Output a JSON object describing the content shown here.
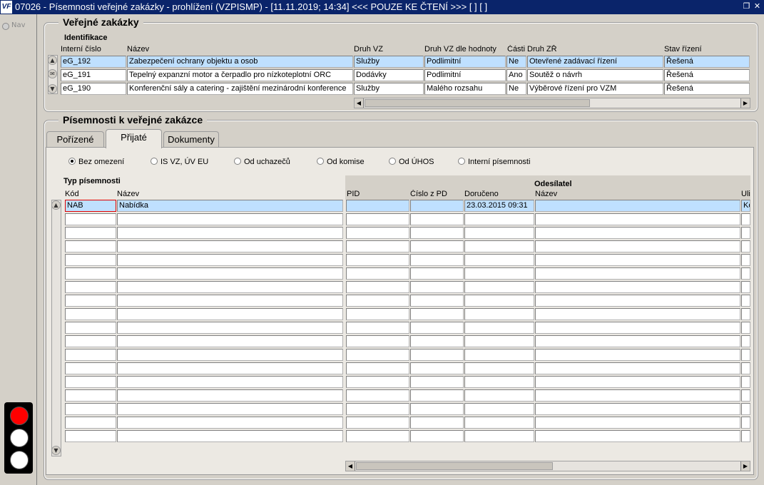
{
  "window": {
    "logo": "VF",
    "title": "07026 - Písemnosti veřejné zakázky - prohlížení (VZPISMP) - [11.11.2019; 14:34] <<< POUZE KE ČTENÍ >>>  [ ]  [ ]",
    "restore_icon": "restore-icon",
    "close_icon": "close-icon"
  },
  "left": {
    "nav_label": "Nav"
  },
  "section_vz": {
    "title": "Veřejné zakázky",
    "subtitle": "Identifikace",
    "columns": [
      "Interní číslo",
      "Název",
      "Druh VZ",
      "Druh VZ dle hodnoty",
      "Části",
      "Druh ZŘ",
      "Stav řízení"
    ],
    "rows": [
      [
        "eG_192",
        "Zabezpečení ochrany objektu a osob",
        "Služby",
        "Podlimitní",
        "Ne",
        "Otevřené zadávací řízení",
        "Řešená"
      ],
      [
        "eG_191",
        "Tepelný expanzní motor a čerpadlo pro nízkoteplotní ORC",
        "Dodávky",
        "Podlimitní",
        "Ano",
        "Soutěž o návrh",
        "Řešená"
      ],
      [
        "eG_190",
        "Konferenční sály a catering - zajištění mezinárodní konference",
        "Služby",
        "Malého rozsahu",
        "Ne",
        "Výběrové řízení pro VZM",
        "Řešená"
      ]
    ],
    "selected_row": 0
  },
  "section_pis": {
    "title": "Písemnosti k veřejné zakázce",
    "tabs": [
      "Pořízené",
      "Přijaté",
      "Dokumenty"
    ],
    "active_tab": 1,
    "filters": [
      "Bez omezení",
      "IS VZ, ÚV EU",
      "Od uchazečů",
      "Od komise",
      "Od ÚHOS",
      "Interní písemnosti"
    ],
    "selected_filter": 0,
    "group_typ": "Typ písemnosti",
    "group_odesilatel": "Odesílatel",
    "columns": [
      "Kód",
      "Název",
      "PID",
      "Číslo z PD",
      "Doručeno",
      "Název",
      "Ulic"
    ],
    "rows": [
      [
        "NAB",
        "Nabídka",
        "",
        "",
        "23.03.2015 09:31",
        "",
        "Ko"
      ]
    ],
    "empty_rows": 17
  },
  "traffic_light": [
    "#ff0000",
    "#ffffff",
    "#ffffff"
  ]
}
